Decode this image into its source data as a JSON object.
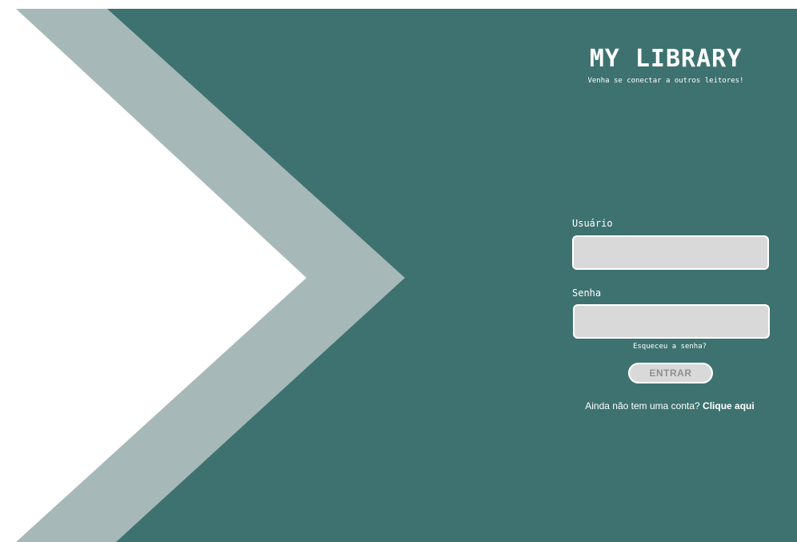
{
  "colors": {
    "background_teal": "#3d7270",
    "chevron_gray": "#a7b8b8",
    "page_white": "#ffffff",
    "field_fill": "#d9d9d9",
    "button_text": "#8f8f8f"
  },
  "brand": {
    "title": "MY LIBRARY",
    "subtitle": "Venha se conectar a outros leitores!"
  },
  "login_form": {
    "username_label": "Usuário",
    "username_value": "",
    "password_label": "Senha",
    "password_value": "",
    "forgot_password": "Esqueceu a senha?",
    "submit_label": "ENTRAR"
  },
  "signup": {
    "prompt": "Ainda não tem uma conta?",
    "link_label": "Clique aqui"
  }
}
